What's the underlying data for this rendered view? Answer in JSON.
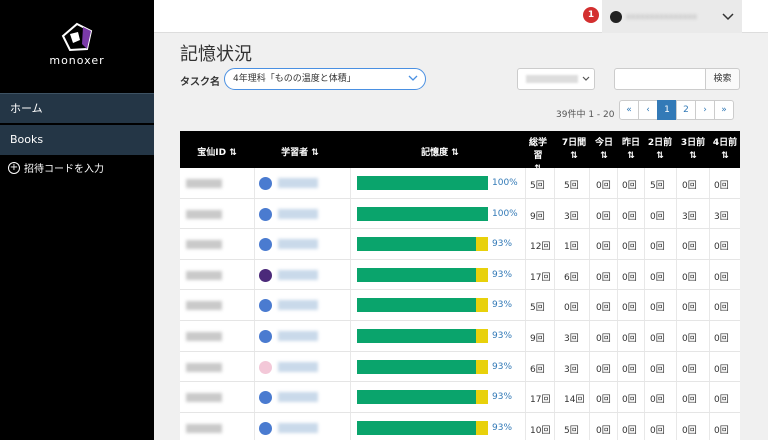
{
  "app": {
    "logo_text": "monoxer"
  },
  "sidebar": {
    "items": [
      {
        "label": "ホーム"
      },
      {
        "label": "Books"
      }
    ],
    "invite_label": "招待コードを入力"
  },
  "topbar": {
    "notification_count": "1"
  },
  "page": {
    "title": "記憶状況"
  },
  "filters": {
    "task_label": "タスク名",
    "task_value": "4年理科「ものの温度と体積」",
    "search_button": "検索"
  },
  "pagination": {
    "result_count": "39件中 1 - 20",
    "pages": [
      "«",
      "‹",
      "1",
      "2",
      "›",
      "»"
    ],
    "active_page": "1"
  },
  "table": {
    "headers": {
      "id": "宝仙ID ⇅",
      "learner": "学習者 ⇅",
      "memory": "記憶度 ⇅",
      "total_line1": "総学習",
      "total_line2": "⇅",
      "d7_line1": "7日間",
      "d7_line2": "⇅",
      "today_line1": "今日",
      "today_line2": "⇅",
      "yday_line1": "昨日",
      "yday_line2": "⇅",
      "d2_line1": "2日前",
      "d2_line2": "⇅",
      "d3_line1": "3日前",
      "d3_line2": "⇅",
      "d4_line1": "4日前",
      "d4_line2": "⇅"
    },
    "rows": [
      {
        "pct_label": "100%",
        "pct": 100,
        "total": "5回",
        "d7": "5回",
        "today": "0回",
        "yday": "0回",
        "d2": "5回",
        "d3": "0回",
        "d4": "0回",
        "avatar": "person-icon"
      },
      {
        "pct_label": "100%",
        "pct": 100,
        "total": "9回",
        "d7": "3回",
        "today": "0回",
        "yday": "0回",
        "d2": "0回",
        "d3": "3回",
        "d4": "3回",
        "avatar": "person-icon"
      },
      {
        "pct_label": "93%",
        "pct": 93,
        "total": "12回",
        "d7": "1回",
        "today": "0回",
        "yday": "0回",
        "d2": "0回",
        "d3": "0回",
        "d4": "0回",
        "avatar": "person-icon"
      },
      {
        "pct_label": "93%",
        "pct": 93,
        "total": "17回",
        "d7": "6回",
        "today": "0回",
        "yday": "0回",
        "d2": "0回",
        "d3": "0回",
        "d4": "0回",
        "avatar": "custom-avatar-icon"
      },
      {
        "pct_label": "93%",
        "pct": 93,
        "total": "5回",
        "d7": "0回",
        "today": "0回",
        "yday": "0回",
        "d2": "0回",
        "d3": "0回",
        "d4": "0回",
        "avatar": "person-icon"
      },
      {
        "pct_label": "93%",
        "pct": 93,
        "total": "9回",
        "d7": "3回",
        "today": "0回",
        "yday": "0回",
        "d2": "0回",
        "d3": "0回",
        "d4": "0回",
        "avatar": "person-icon"
      },
      {
        "pct_label": "93%",
        "pct": 93,
        "total": "6回",
        "d7": "3回",
        "today": "0回",
        "yday": "0回",
        "d2": "0回",
        "d3": "0回",
        "d4": "0回",
        "avatar": "flower-avatar-icon"
      },
      {
        "pct_label": "93%",
        "pct": 93,
        "total": "17回",
        "d7": "14回",
        "today": "0回",
        "yday": "0回",
        "d2": "0回",
        "d3": "0回",
        "d4": "0回",
        "avatar": "person-icon"
      },
      {
        "pct_label": "93%",
        "pct": 93,
        "total": "10回",
        "d7": "5回",
        "today": "0回",
        "yday": "0回",
        "d2": "0回",
        "d3": "0回",
        "d4": "0回",
        "avatar": "person-icon"
      }
    ]
  },
  "colors": {
    "bar_green": "#0aa46c",
    "bar_yellow": "#e8d10b",
    "link_blue": "#337ab7",
    "sidebar_bg": "#000000",
    "nav_active_bg": "#243646"
  }
}
